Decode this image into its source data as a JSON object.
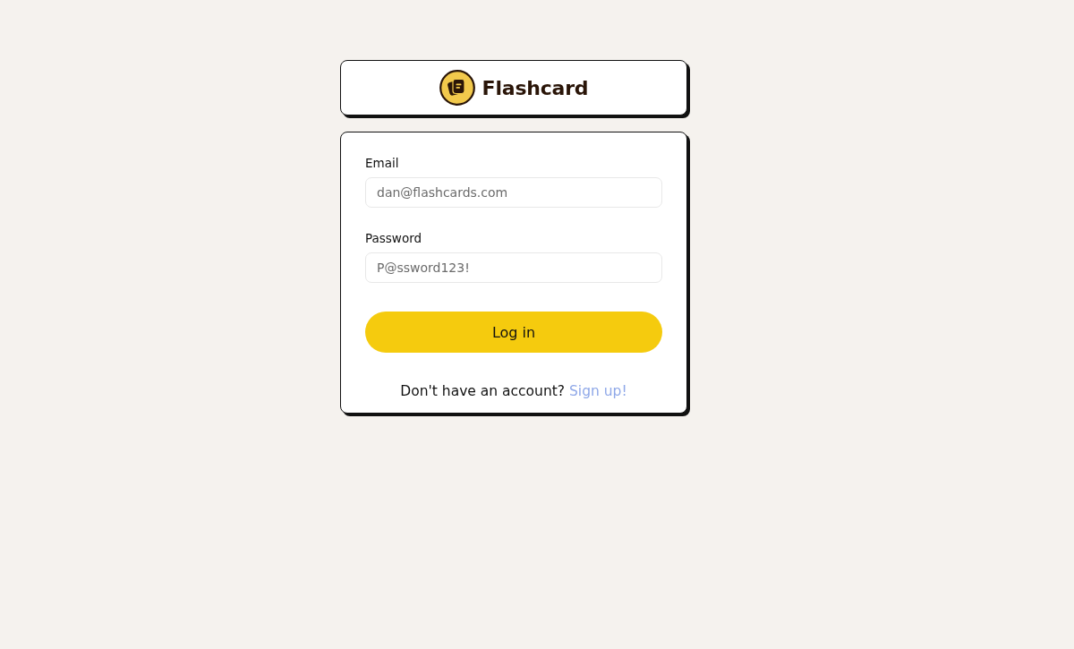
{
  "header": {
    "title": "Flashcard"
  },
  "form": {
    "fields": [
      {
        "label": "Email",
        "placeholder": "dan@flashcards.com"
      },
      {
        "label": "Password",
        "placeholder": "P@ssword123!"
      }
    ],
    "submit_button": "Log in",
    "footer": {
      "prompt": "Don't have an account?",
      "link": "Sign up!"
    }
  }
}
